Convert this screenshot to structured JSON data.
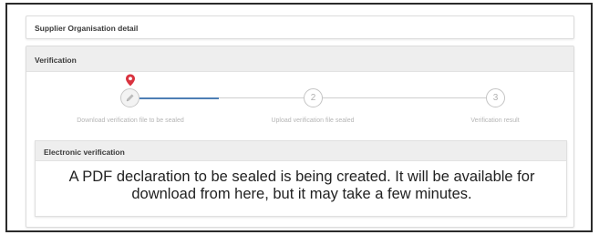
{
  "supplier_card": {
    "title": "Supplier Organisation detail"
  },
  "verification": {
    "title": "Verification",
    "current_step": 1,
    "steps": [
      {
        "number": "",
        "icon": "pencil-icon",
        "label": "Download verification file to be sealed"
      },
      {
        "number": "2",
        "label": "Upload verification file sealed"
      },
      {
        "number": "3",
        "label": "Verification result"
      }
    ],
    "accent_color": "#4d7fb5",
    "marker_color": "#d9333f"
  },
  "electronic_verification": {
    "title": "Electronic verification",
    "message": "A PDF declaration to be sealed is being created. It will be available for download from here, but it may take a few minutes."
  }
}
